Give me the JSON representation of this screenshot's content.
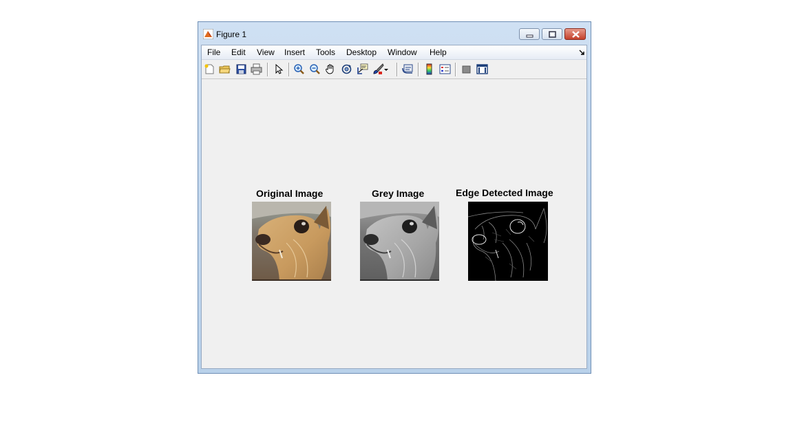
{
  "window": {
    "title": "Figure 1"
  },
  "menu": {
    "items": [
      "File",
      "Edit",
      "View",
      "Insert",
      "Tools",
      "Desktop",
      "Window",
      "Help"
    ]
  },
  "toolbar": {
    "icons": [
      "new-figure-icon",
      "open-file-icon",
      "save-icon",
      "print-icon",
      "edit-plot-arrow-icon",
      "zoom-in-icon",
      "zoom-out-icon",
      "pan-hand-icon",
      "rotate-3d-icon",
      "data-cursor-icon",
      "brush-icon",
      "brush-dropdown-icon",
      "link-plot-icon",
      "insert-colorbar-icon",
      "insert-legend-icon",
      "hide-plot-tools-icon",
      "show-plot-tools-icon"
    ]
  },
  "plots": {
    "original_title": "Original Image",
    "grey_title": "Grey Image",
    "edge_title": "Edge Detected Image"
  }
}
